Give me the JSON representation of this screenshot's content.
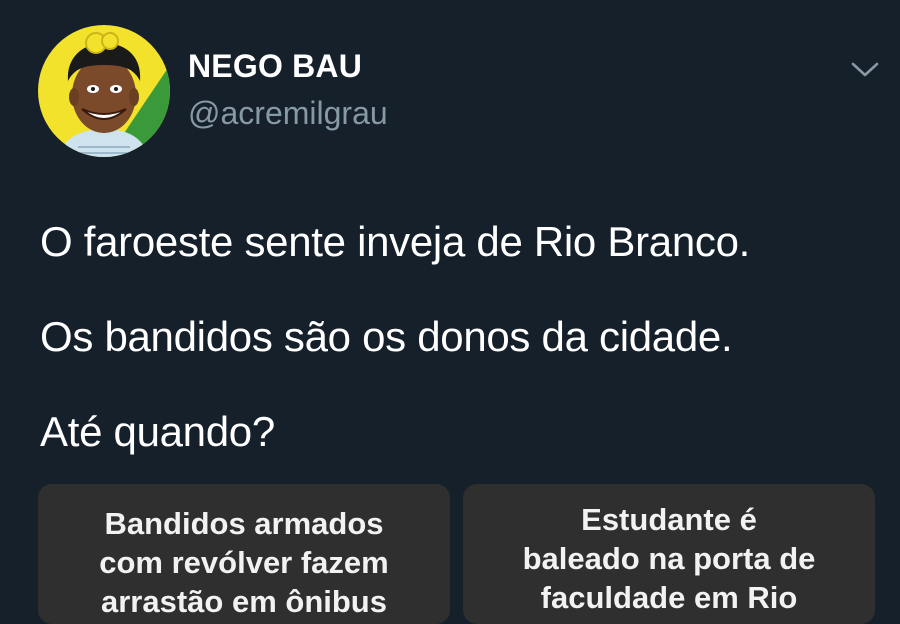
{
  "author": {
    "display_name": "NEGO BAU",
    "handle": "@acremilgrau",
    "avatar_icon": "cartoon-avatar-icon",
    "menu_icon": "chevron-down-icon"
  },
  "tweet": {
    "lines": [
      "O faroeste sente inveja de Rio Branco.",
      "Os bandidos são os donos da cidade.",
      "Até quando?"
    ]
  },
  "cards": [
    {
      "headline_lines": [
        "Bandidos armados",
        "com revólver fazem",
        "arrastão em ônibus"
      ]
    },
    {
      "headline_lines": [
        "Estudante é",
        "baleado na porta de",
        "faculdade em Rio"
      ]
    }
  ],
  "colors": {
    "background": "#15202b",
    "secondary_text": "#8899a6",
    "card_background": "#2f2f2f"
  }
}
